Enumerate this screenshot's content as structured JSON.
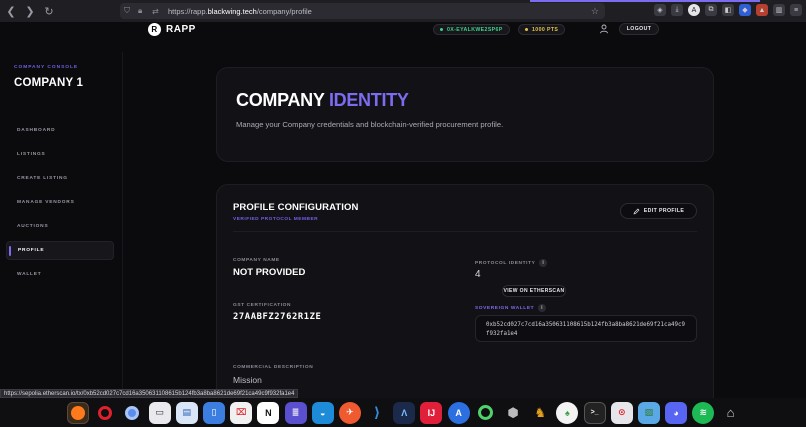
{
  "browser": {
    "url_scheme": "https://rapp.",
    "url_domain": "blackwing.tech",
    "url_path": "/company/profile"
  },
  "header": {
    "logo_letter": "R",
    "logo_text": "RAPP",
    "wallet_pill": "0X-EYALKWE2SP6P",
    "points_pill": "1000 PTS",
    "logout_label": "LOGOUT"
  },
  "sidebar": {
    "console_label": "COMPANY CONSOLE",
    "company_name": "COMPANY 1",
    "items": [
      {
        "label": "DASHBOARD"
      },
      {
        "label": "LISTINGS"
      },
      {
        "label": "CREATE LISTING"
      },
      {
        "label": "MANAGE VENDORS"
      },
      {
        "label": "AUCTIONS"
      },
      {
        "label": "PROFILE"
      },
      {
        "label": "WALLET"
      }
    ]
  },
  "hero": {
    "title_main": "COMPANY ",
    "title_accent": "IDENTITY",
    "description": "Manage your Company credentials and blockchain-verified procurement profile."
  },
  "profile": {
    "title": "PROFILE CONFIGURATION",
    "subtitle": "VERIFIED PROTOCOL MEMBER",
    "edit_label": "EDIT PROFILE",
    "company_name_label": "COMPANY NAME",
    "company_name_value": "NOT PROVIDED",
    "gst_label": "GST CERTIFICATION",
    "gst_value": "27AABFZ2762R1ZE",
    "commercial_label": "COMMERCIAL DESCRIPTION",
    "commercial_value": "Mission",
    "protocol_label": "PROTOCOL IDENTITY",
    "protocol_value": "4",
    "etherscan_label": "VIEW ON ETHERSCAN",
    "wallet_label": "SOVEREIGN WALLET",
    "wallet_value": "0xb52cd027c7cd16a350631108615b124fb3a8ba8621de69f21ca49c9f932fa1e4"
  },
  "status_bar": {
    "link": "https://sepolia.etherscan.io/tx/0xb52cd027c7cd16a350631108615b124fb3a8ba8621de69f21ca49c9f932fa1e4"
  },
  "colors": {
    "accent": "#7c6cf0",
    "background": "#0b0b0e",
    "card": "#121216"
  }
}
